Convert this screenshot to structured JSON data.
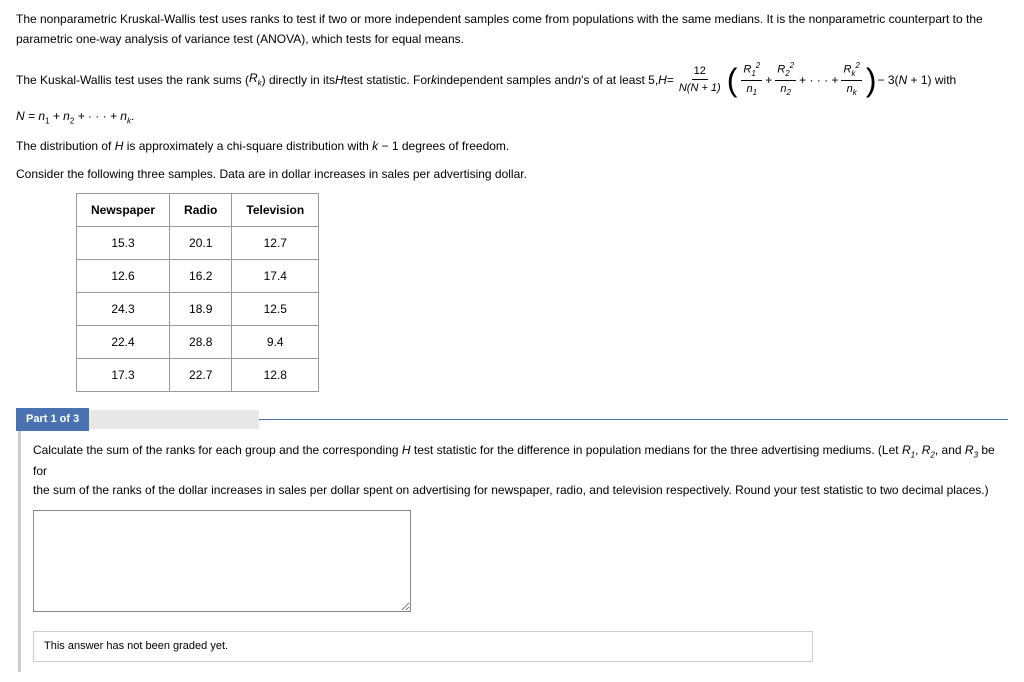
{
  "intro1": "The nonparametric Kruskal-Wallis test uses ranks to test if two or more independent samples come from populations with the same medians. It is the nonparametric counterpart to the",
  "intro2": "parametric one-way analysis of variance test (ANOVA), which tests for equal means.",
  "formula_pre": "The Kuskal-Wallis test uses the rank sums (",
  "formula_rk": "R",
  "formula_ksub": "k",
  "formula_mid": ") directly in its ",
  "formula_H": "H",
  "formula_mid2": " test statistic. For ",
  "formula_k": "k",
  "formula_mid3": " independent samples and ",
  "formula_n": "n",
  "formula_mid4": "'s of at least 5, ",
  "formula_Heq": "H",
  "formula_eq": " = ",
  "twelve": "12",
  "NNp1": "N(N + 1)",
  "R": "R",
  "n_l": "n",
  "one": "1",
  "two": "2",
  "sq": "2",
  "plus": " + ",
  "dotsplus": " + · · · + ",
  "minus3": " − 3(",
  "Np1with": " + 1) with",
  "Neq": "N = n",
  "plus_n": " + n",
  "dots_n": " + · · · + n",
  "dot": ".",
  "dist_text1": "The distribution of ",
  "dist_text2": " is approximately a chi-square distribution with ",
  "dist_text3": " − 1 degrees of freedom.",
  "consider": "Consider the following three samples. Data are in dollar increases in sales per advertising dollar.",
  "headers": {
    "c1": "Newspaper",
    "c2": "Radio",
    "c3": "Television"
  },
  "rows": [
    {
      "c1": "15.3",
      "c2": "20.1",
      "c3": "12.7"
    },
    {
      "c1": "12.6",
      "c2": "16.2",
      "c3": "17.4"
    },
    {
      "c1": "24.3",
      "c2": "18.9",
      "c3": "12.5"
    },
    {
      "c1": "22.4",
      "c2": "28.8",
      "c3": "9.4"
    },
    {
      "c1": "17.3",
      "c2": "22.7",
      "c3": "12.8"
    }
  ],
  "part_label": "Part 1 of 3",
  "q1a": "Calculate the sum of the ranks for each group and the corresponding ",
  "q1b": " test statistic for the difference in population medians for the three advertising mediums. (Let ",
  "q1c": ", ",
  "q1d": ", and ",
  "q1e": " be for",
  "q2": "the sum of the ranks of the dollar increases in sales per dollar spent on advertising for newspaper, radio, and television respectively. Round your test statistic to two decimal places.)",
  "three": "3",
  "grade_note": "This answer has not been graded yet.",
  "chart_data": {
    "type": "table",
    "title": "Dollar increases in sales per advertising dollar",
    "columns": [
      "Newspaper",
      "Radio",
      "Television"
    ],
    "data": [
      [
        15.3,
        20.1,
        12.7
      ],
      [
        12.6,
        16.2,
        17.4
      ],
      [
        24.3,
        18.9,
        12.5
      ],
      [
        22.4,
        28.8,
        9.4
      ],
      [
        17.3,
        22.7,
        12.8
      ]
    ]
  }
}
